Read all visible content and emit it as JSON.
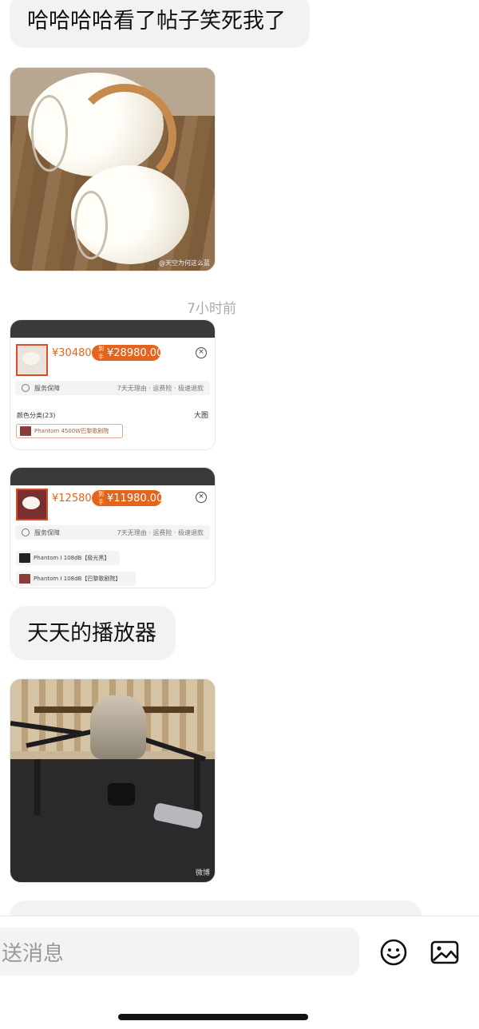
{
  "messages": {
    "first_text": "哈哈哈哈看了帖子笑死我了",
    "speaker_watermark": "@天空为何这么蓝",
    "timestamp": "7小时前",
    "second_text": "天天的播放器",
    "drone_watermark": "微博"
  },
  "product_card_1": {
    "price_original": "¥30480",
    "price_tag": "到手",
    "price_discount": "¥28980.00",
    "service_label": "服务保障",
    "service_detail": "7天无理由 · 运费险 · 极速退款",
    "color_label": "颜色分类(23)",
    "big_image_label": "大图",
    "option": "Phantom 4500W巴黎歌剧院"
  },
  "product_card_2": {
    "price_original": "¥12580",
    "price_tag": "到手",
    "price_discount": "¥11980.00",
    "service_label": "服务保障",
    "service_detail": "7天无理由 · 运费险 · 极速退款",
    "option_1": "Phantom Ⅰ 108dB【极光黑】",
    "option_2": "Phantom Ⅰ 108dB【巴黎歌剧院】"
  },
  "input": {
    "placeholder": "送消息"
  },
  "icons": {
    "emoji": "emoji-icon",
    "image": "image-icon"
  },
  "colors": {
    "price_accent": "#e2641d",
    "bubble_bg": "#f2f2f2"
  }
}
